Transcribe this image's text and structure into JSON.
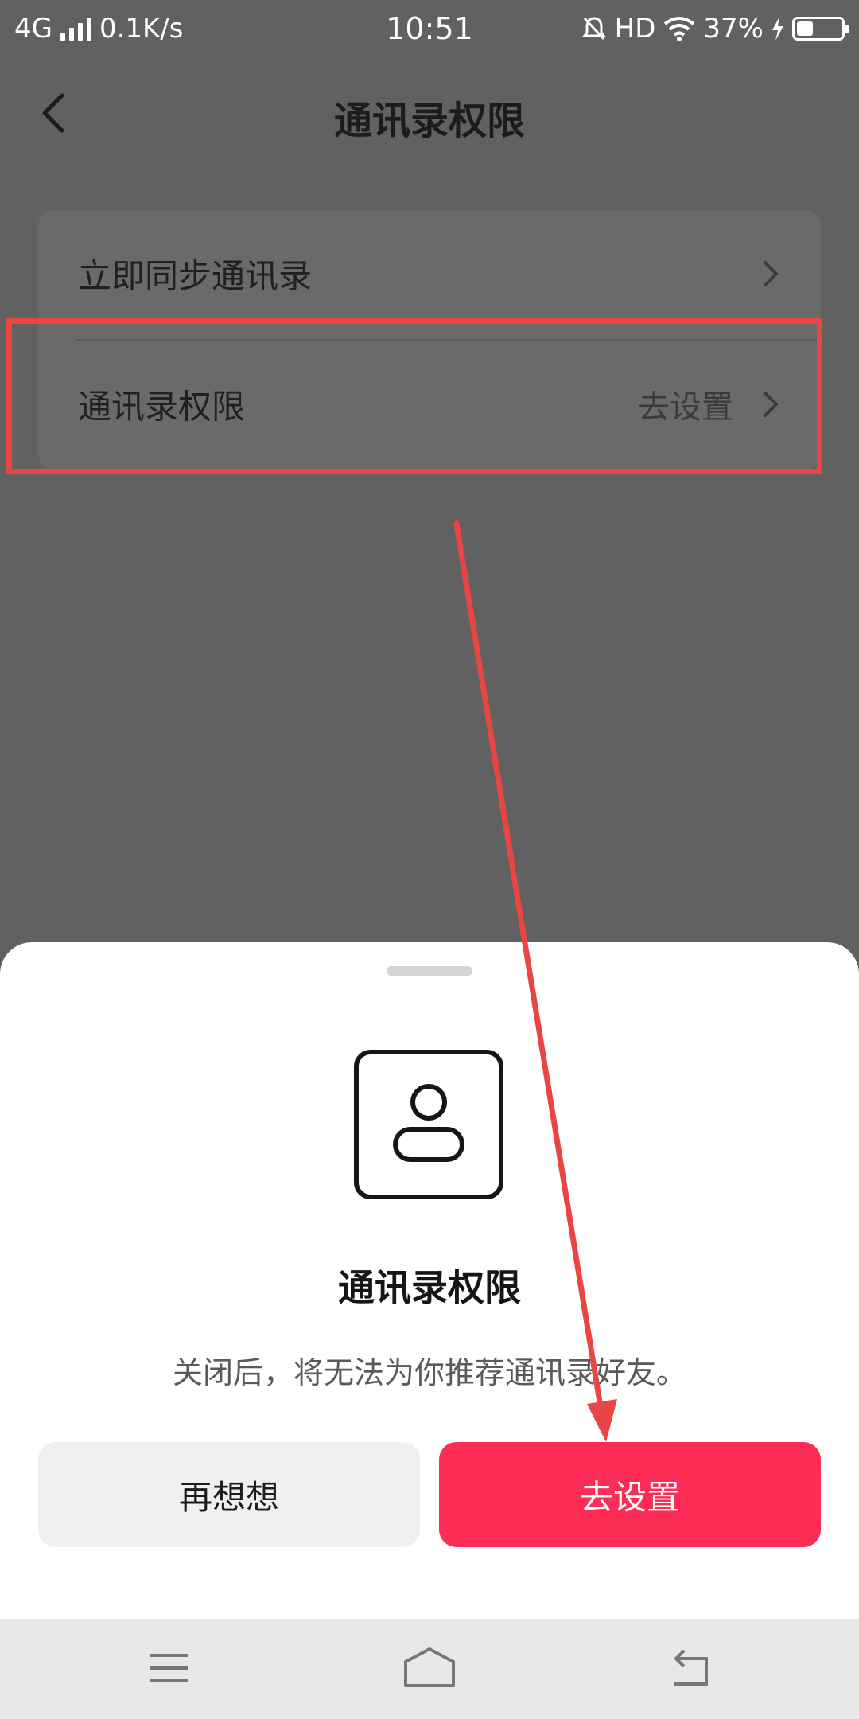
{
  "status_bar": {
    "network": "4G",
    "speed": "0.1K/s",
    "time": "10:51",
    "hd": "HD",
    "battery_percent": "37%",
    "battery_level": 0.37
  },
  "header": {
    "title": "通讯录权限"
  },
  "settings": {
    "sync_label": "立即同步通讯录",
    "permission_label": "通讯录权限",
    "permission_value": "去设置"
  },
  "sheet": {
    "title": "通讯录权限",
    "description": "关闭后，将无法为你推荐通讯录好友。",
    "cancel_label": "再想想",
    "confirm_label": "去设置"
  },
  "colors": {
    "accent": "#fc2c55",
    "annotation": "#e84545"
  },
  "icons": [
    "back-arrow-icon",
    "chevron-right-icon",
    "contact-person-icon",
    "menu-icon",
    "home-icon",
    "back-icon"
  ]
}
